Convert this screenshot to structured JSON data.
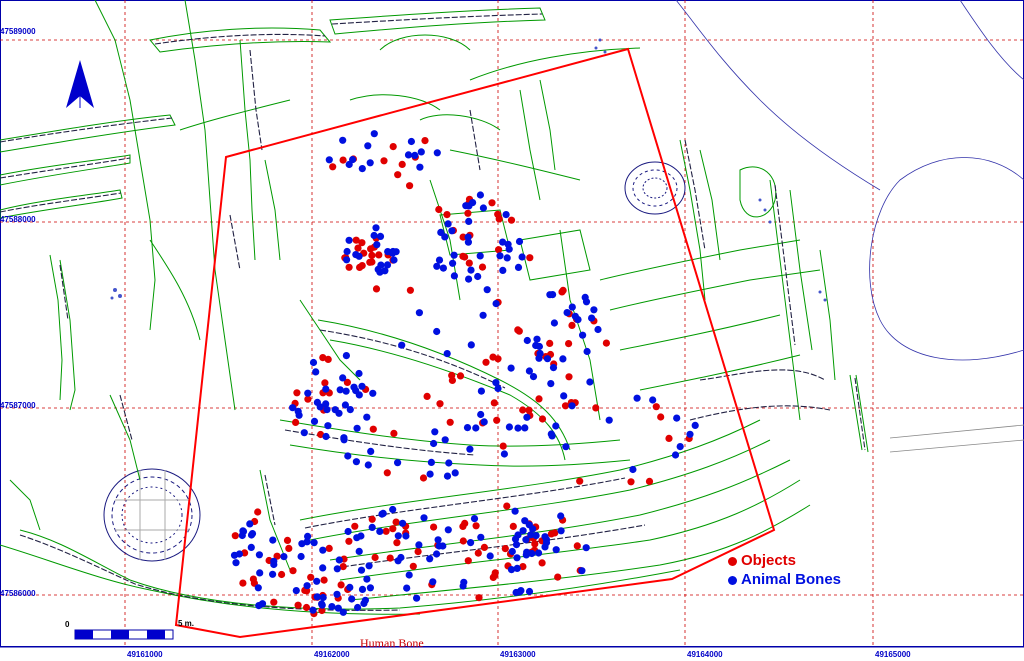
{
  "map": {
    "grid": {
      "x_labels": [
        "49161000",
        "49162000",
        "49163000",
        "49164000",
        "49165000"
      ],
      "y_labels": [
        "47589000",
        "47588000",
        "47587000",
        "47586000"
      ]
    },
    "legend": {
      "items": [
        {
          "label": "Objects",
          "color": "#e00000"
        },
        {
          "label": "Animal Bones",
          "color": "#0010e0"
        }
      ]
    },
    "annotations": {
      "human_bone": "Human Bone"
    },
    "scale_bar": {
      "start": "0",
      "end": "5 m."
    },
    "north_arrow": "north-arrow-icon",
    "colors": {
      "boundary": "#ff0000",
      "features": "#009900",
      "grid": "#cc0000",
      "contour": "#3333aa",
      "objects": "#e00000",
      "animal_bones": "#0010e0"
    }
  }
}
